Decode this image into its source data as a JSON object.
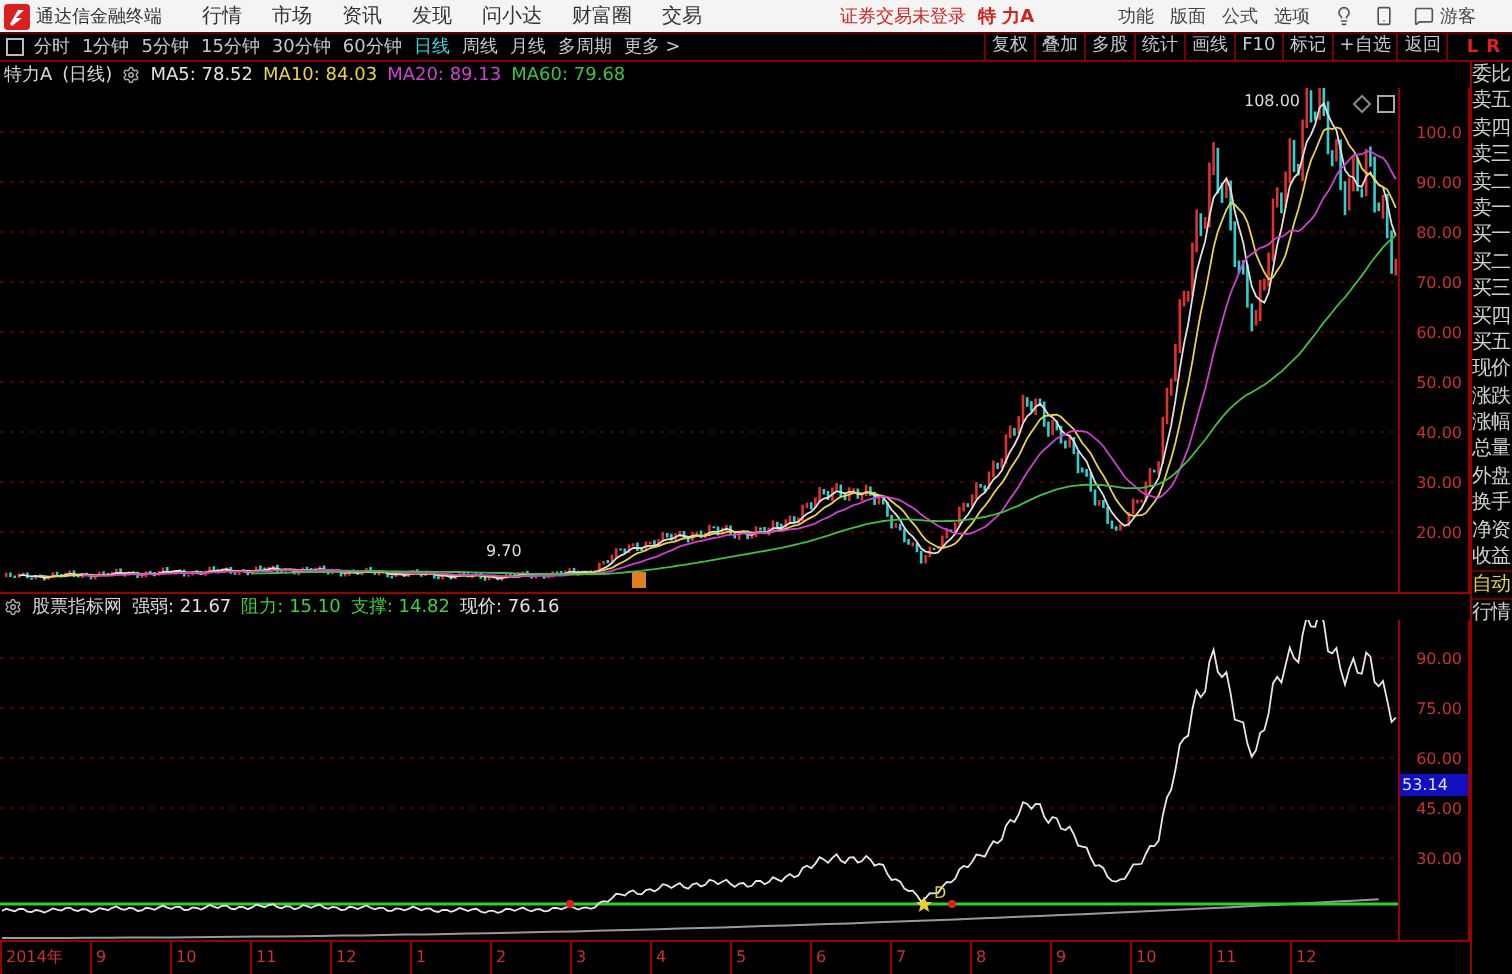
{
  "top_bar": {
    "app_title": "通达信金融终端",
    "menu": [
      "行情",
      "市场",
      "资讯",
      "发现",
      "问小达",
      "财富圈",
      "交易"
    ],
    "login_status": "证券交易未登录",
    "stock": "特 力A",
    "tools": [
      "功能",
      "版面",
      "公式",
      "选项"
    ],
    "user": "游客"
  },
  "period_tabs": [
    {
      "label": "分时",
      "selected": false
    },
    {
      "label": "1分钟",
      "selected": false
    },
    {
      "label": "5分钟",
      "selected": false
    },
    {
      "label": "15分钟",
      "selected": false
    },
    {
      "label": "30分钟",
      "selected": false
    },
    {
      "label": "60分钟",
      "selected": false
    },
    {
      "label": "日线",
      "selected": true
    },
    {
      "label": "周线",
      "selected": false
    },
    {
      "label": "月线",
      "selected": false
    },
    {
      "label": "多周期",
      "selected": false
    },
    {
      "label": "更多 >",
      "selected": false
    }
  ],
  "chart_tools": [
    "复权",
    "叠加",
    "多股",
    "统计",
    "画线",
    "F10",
    "标记",
    "+自选",
    "返回"
  ],
  "corner_labels": [
    "L",
    "R"
  ],
  "price_pane": {
    "title": "特力A",
    "period": "(日线)",
    "indicators": [
      {
        "label": "MA5: 78.52",
        "color": "#e0e0e0"
      },
      {
        "label": "MA10: 84.03",
        "color": "#e8d44a"
      },
      {
        "label": "MA20: 89.13",
        "color": "#d040d0"
      },
      {
        "label": "MA60: 79.68",
        "color": "#40c040"
      }
    ],
    "y_ticks": [
      "100.0",
      "90.00",
      "80.00",
      "70.00",
      "60.00",
      "50.00",
      "40.00",
      "30.00",
      "20.00"
    ],
    "high_label": "108.00",
    "low_label": "9.70"
  },
  "indicator_pane": {
    "name": "股票指标网",
    "values": [
      {
        "label": "强弱: 21.67",
        "color": "#e0e0e0"
      },
      {
        "label": "阻力: 15.10",
        "color": "#40d040"
      },
      {
        "label": "支撑: 14.82",
        "color": "#40d040"
      },
      {
        "label": "现价: 76.16",
        "color": "#e0e0e0"
      }
    ],
    "y_ticks": [
      "90.00",
      "75.00",
      "60.00",
      "45.00",
      "30.00"
    ],
    "current_value": "53.14",
    "marker_label": "D"
  },
  "date_axis": [
    "2014年",
    "9",
    "10",
    "11",
    "12",
    "1",
    "2",
    "3",
    "4",
    "5",
    "6",
    "7",
    "8",
    "9",
    "10",
    "11",
    "12"
  ],
  "quote_panel": {
    "fields": [
      "委比",
      "卖五",
      "卖四",
      "卖三",
      "卖二",
      "卖一",
      "买一",
      "买二",
      "买三",
      "买四",
      "买五",
      "现价",
      "涨跌",
      "涨幅",
      "总量",
      "外盘",
      "换手",
      "净资",
      "收益"
    ],
    "buttons": [
      {
        "label": "自动",
        "selected": true
      },
      {
        "label": "行情",
        "selected": false
      }
    ]
  }
}
